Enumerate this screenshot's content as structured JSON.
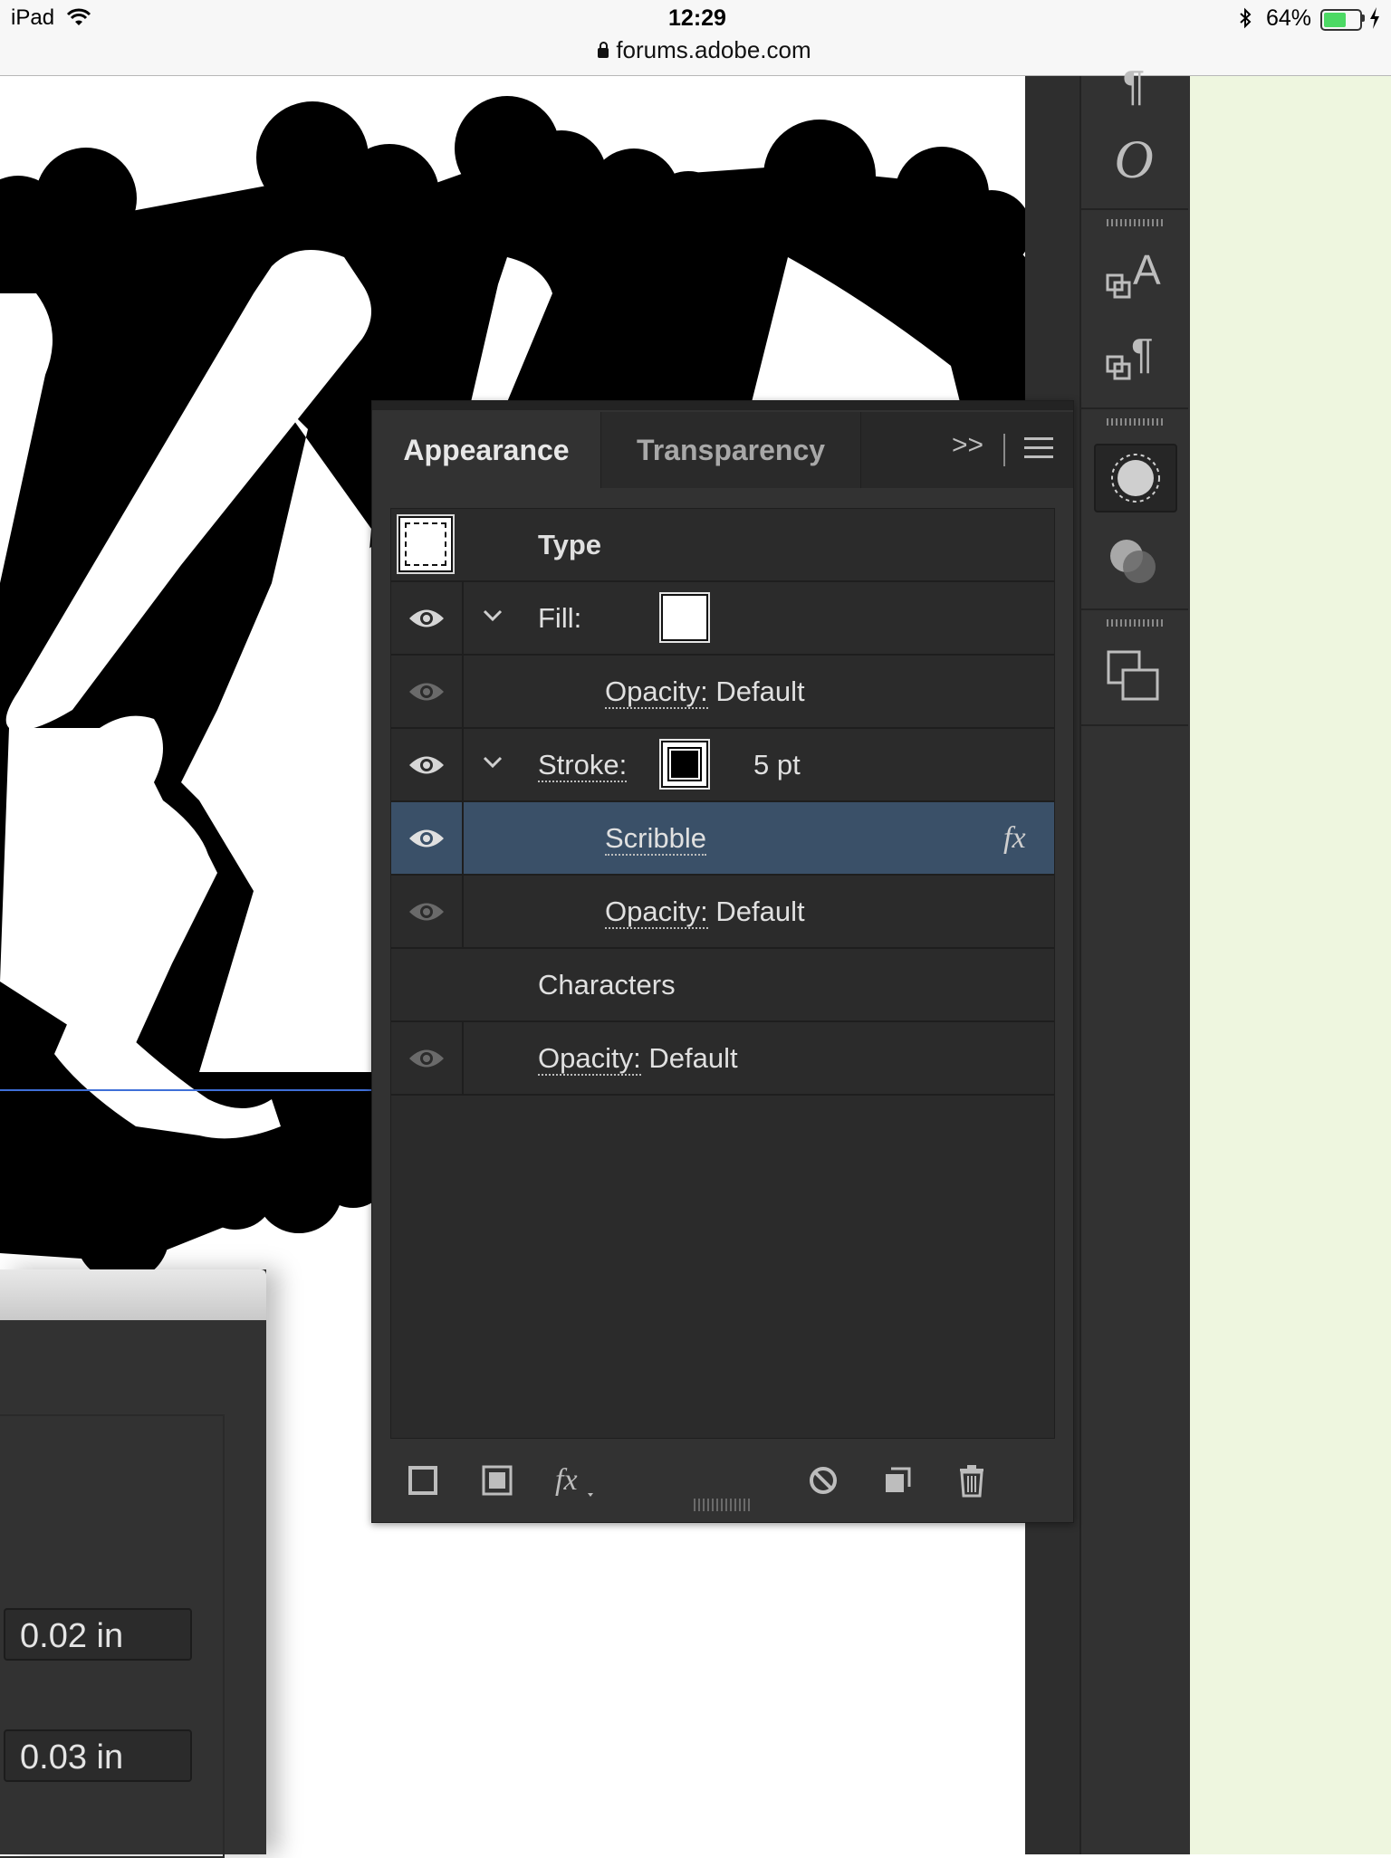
{
  "status_bar": {
    "device": "iPad",
    "time": "12:29",
    "url": "forums.adobe.com",
    "battery_percent": "64%",
    "battery_level": 0.64
  },
  "tools": [
    {
      "name": "paragraph-icon",
      "glyph": "¶"
    },
    {
      "name": "opentype-icon",
      "glyph": "O"
    },
    {
      "name": "character-styles-icon",
      "glyph": "A"
    },
    {
      "name": "paragraph-styles-icon",
      "glyph": "¶"
    },
    {
      "name": "appearance-icon"
    },
    {
      "name": "transparency-icon"
    },
    {
      "name": "artboards-icon"
    }
  ],
  "panel": {
    "tabs": {
      "active": "Appearance",
      "inactive": "Transparency",
      "more": ">>"
    },
    "rows": {
      "type": "Type",
      "fill_label": "Fill:",
      "fill_opacity_label": "Opacity:",
      "fill_opacity_value": "Default",
      "stroke_label": "Stroke:",
      "stroke_weight": "5 pt",
      "scribble": "Scribble",
      "fx_glyph": "fx",
      "stroke_opacity_label": "Opacity:",
      "stroke_opacity_value": "Default",
      "characters": "Characters",
      "opacity_label": "Opacity:",
      "opacity_value": "Default"
    },
    "bottom_icons": [
      "add-new-stroke-icon",
      "add-new-fill-icon",
      "add-effect-icon",
      "clear-appearance-icon",
      "duplicate-item-icon",
      "delete-icon"
    ],
    "selected_color": "#3a5068"
  },
  "dialog": {
    "field1": "0.02 in",
    "field2": "0.03 in"
  }
}
